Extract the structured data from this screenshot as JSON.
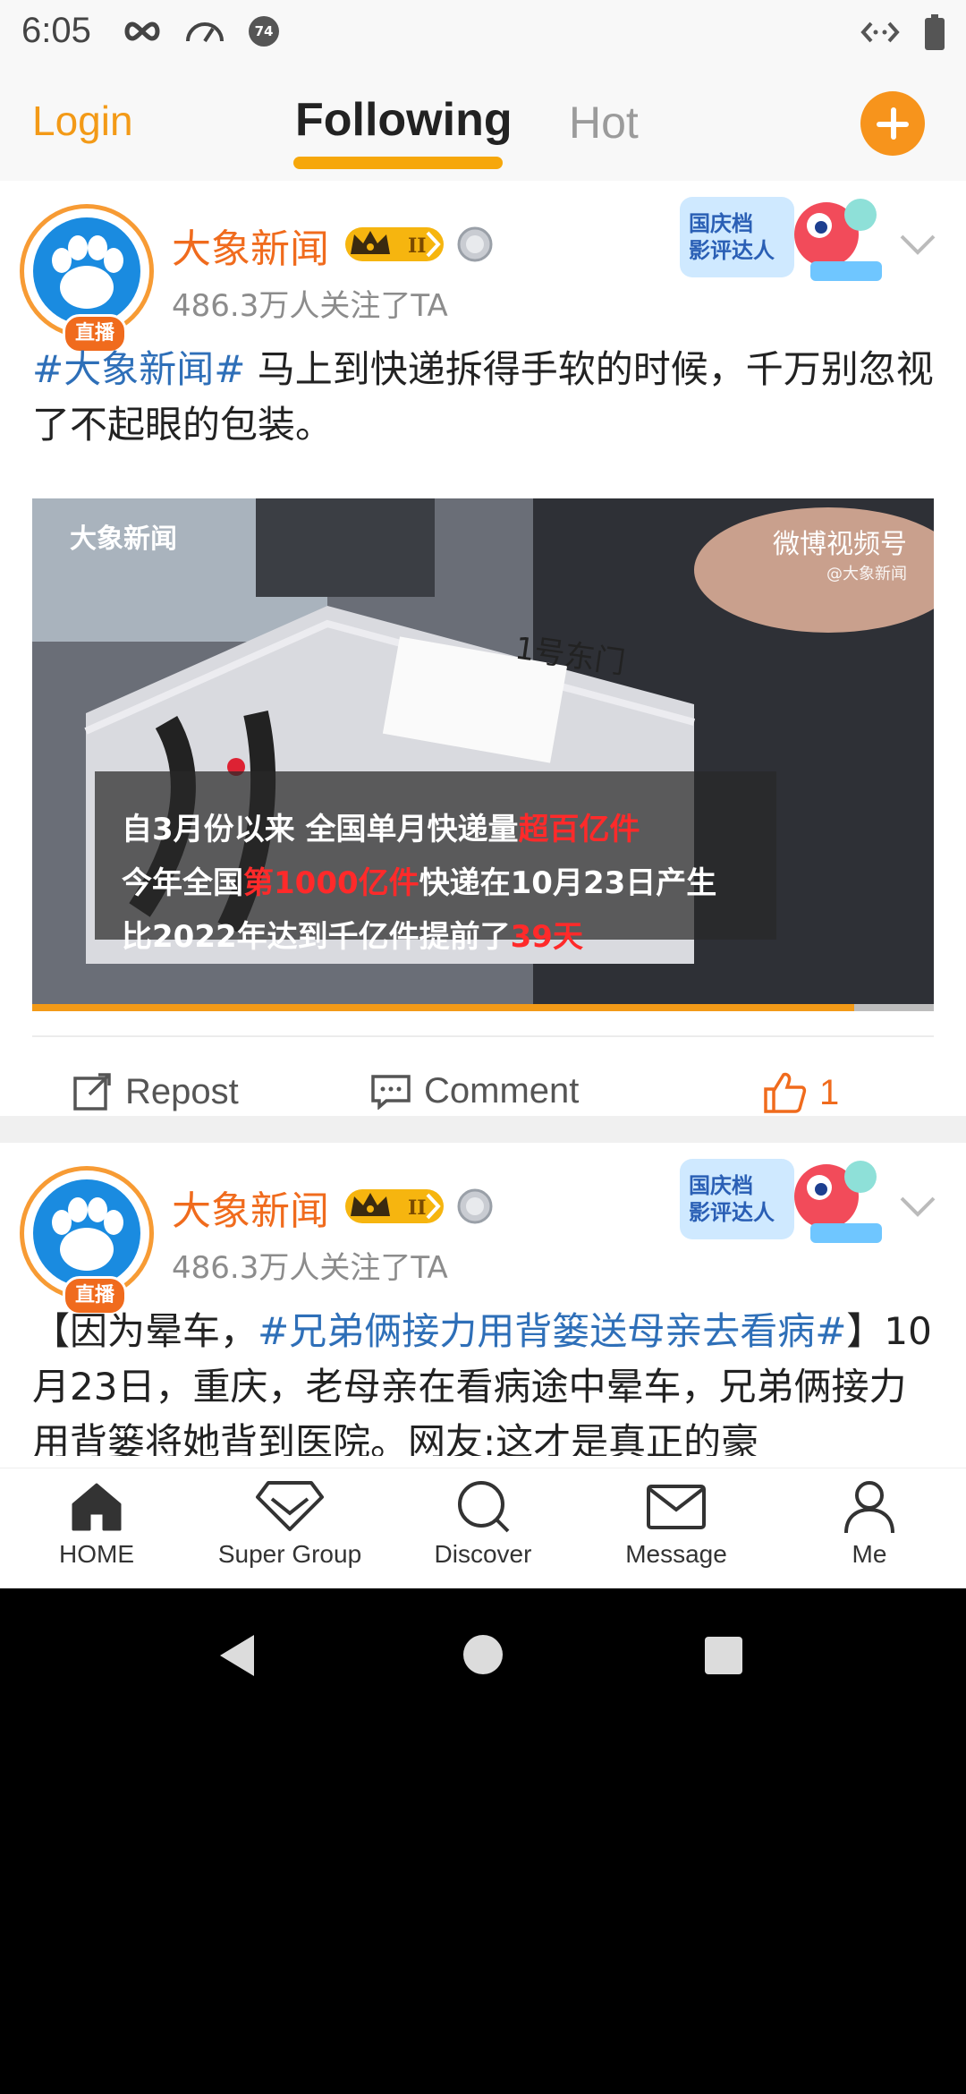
{
  "status_bar": {
    "time": "6:05",
    "notification_badge": "74",
    "icons": [
      "infinity-icon",
      "speedometer-icon",
      "notification-badge-icon",
      "code-icon",
      "battery-icon"
    ]
  },
  "top_nav": {
    "login": "Login",
    "tabs": [
      "Following",
      "Hot"
    ],
    "active_tab": "Following",
    "accent_color": "#f6a70b"
  },
  "posts": [
    {
      "author": "大象新闻",
      "followers": "486.3万人关注了TA",
      "live_badge": "直播",
      "level": "II",
      "content_hashtag": "#大象新闻#",
      "content_text": " 马上到快递拆得手软的时候，千万别忽视了不起眼的包装。",
      "video": {
        "channel_logo": "大象新闻",
        "watermark": "微博视频号",
        "watermark_handle": "@大象新闻",
        "label_text": "1号东门",
        "caption_lines": [
          {
            "pre": "自3月份以来 全国单月快递量",
            "red": "超百亿件",
            "post": ""
          },
          {
            "pre": "今年全国",
            "red": "第1000亿件",
            "post": "快递在10月23日产生"
          },
          {
            "pre": "比2022年达到千亿件提前了",
            "red": "39天",
            "post": ""
          }
        ],
        "progress": 0.912
      },
      "actions": {
        "repost": "Repost",
        "comment": "Comment",
        "likes": "1"
      }
    },
    {
      "author": "大象新闻",
      "followers": "486.3万人关注了TA",
      "live_badge": "直播",
      "level": "II",
      "content_pre": "【因为晕车，",
      "content_hashtag": "#兄弟俩接力用背篓送母亲去看病#",
      "content_post": "】10月23日，重庆，老母亲在看病途中晕车，兄弟俩接力用背篓将她背到医院。网友:这才是真正的豪"
    }
  ],
  "promo_badge": "国庆档影评达人",
  "bottom_tabs": [
    "HOME",
    "Super Group",
    "Discover",
    "Message",
    "Me"
  ]
}
